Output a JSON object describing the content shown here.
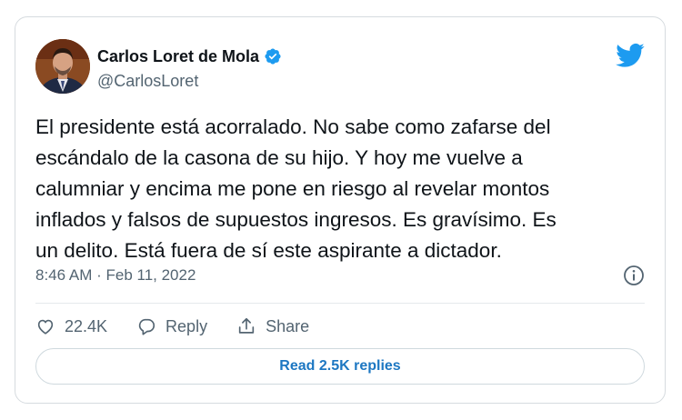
{
  "author": {
    "display_name": "Carlos Loret de Mola",
    "handle": "@CarlosLoret",
    "verified": true,
    "avatar_icon": "profile-photo"
  },
  "brand": {
    "icon": "twitter-bird-icon",
    "color": "#1d9bf0"
  },
  "tweet": {
    "lines": [
      "El presidente está acorralado. No sabe como zafarse del",
      "escándalo de la casona de su hijo. Y hoy me vuelve a",
      "calumniar y encima me pone en riesgo al revelar montos",
      "inflados y falsos de supuestos ingresos. Es gravísimo. Es",
      "un delito. Está fuera de sí este aspirante a dictador."
    ],
    "timestamp": "8:46 AM · Feb 11, 2022",
    "info_icon": "info-icon"
  },
  "actions": {
    "like_count": "22.4K",
    "reply_label": "Reply",
    "share_label": "Share",
    "read_replies_label": "Read 2.5K replies"
  },
  "colors": {
    "text_primary": "#0f1419",
    "text_secondary": "#536471",
    "link": "#1d77c2",
    "border": "#d6dbdf"
  }
}
